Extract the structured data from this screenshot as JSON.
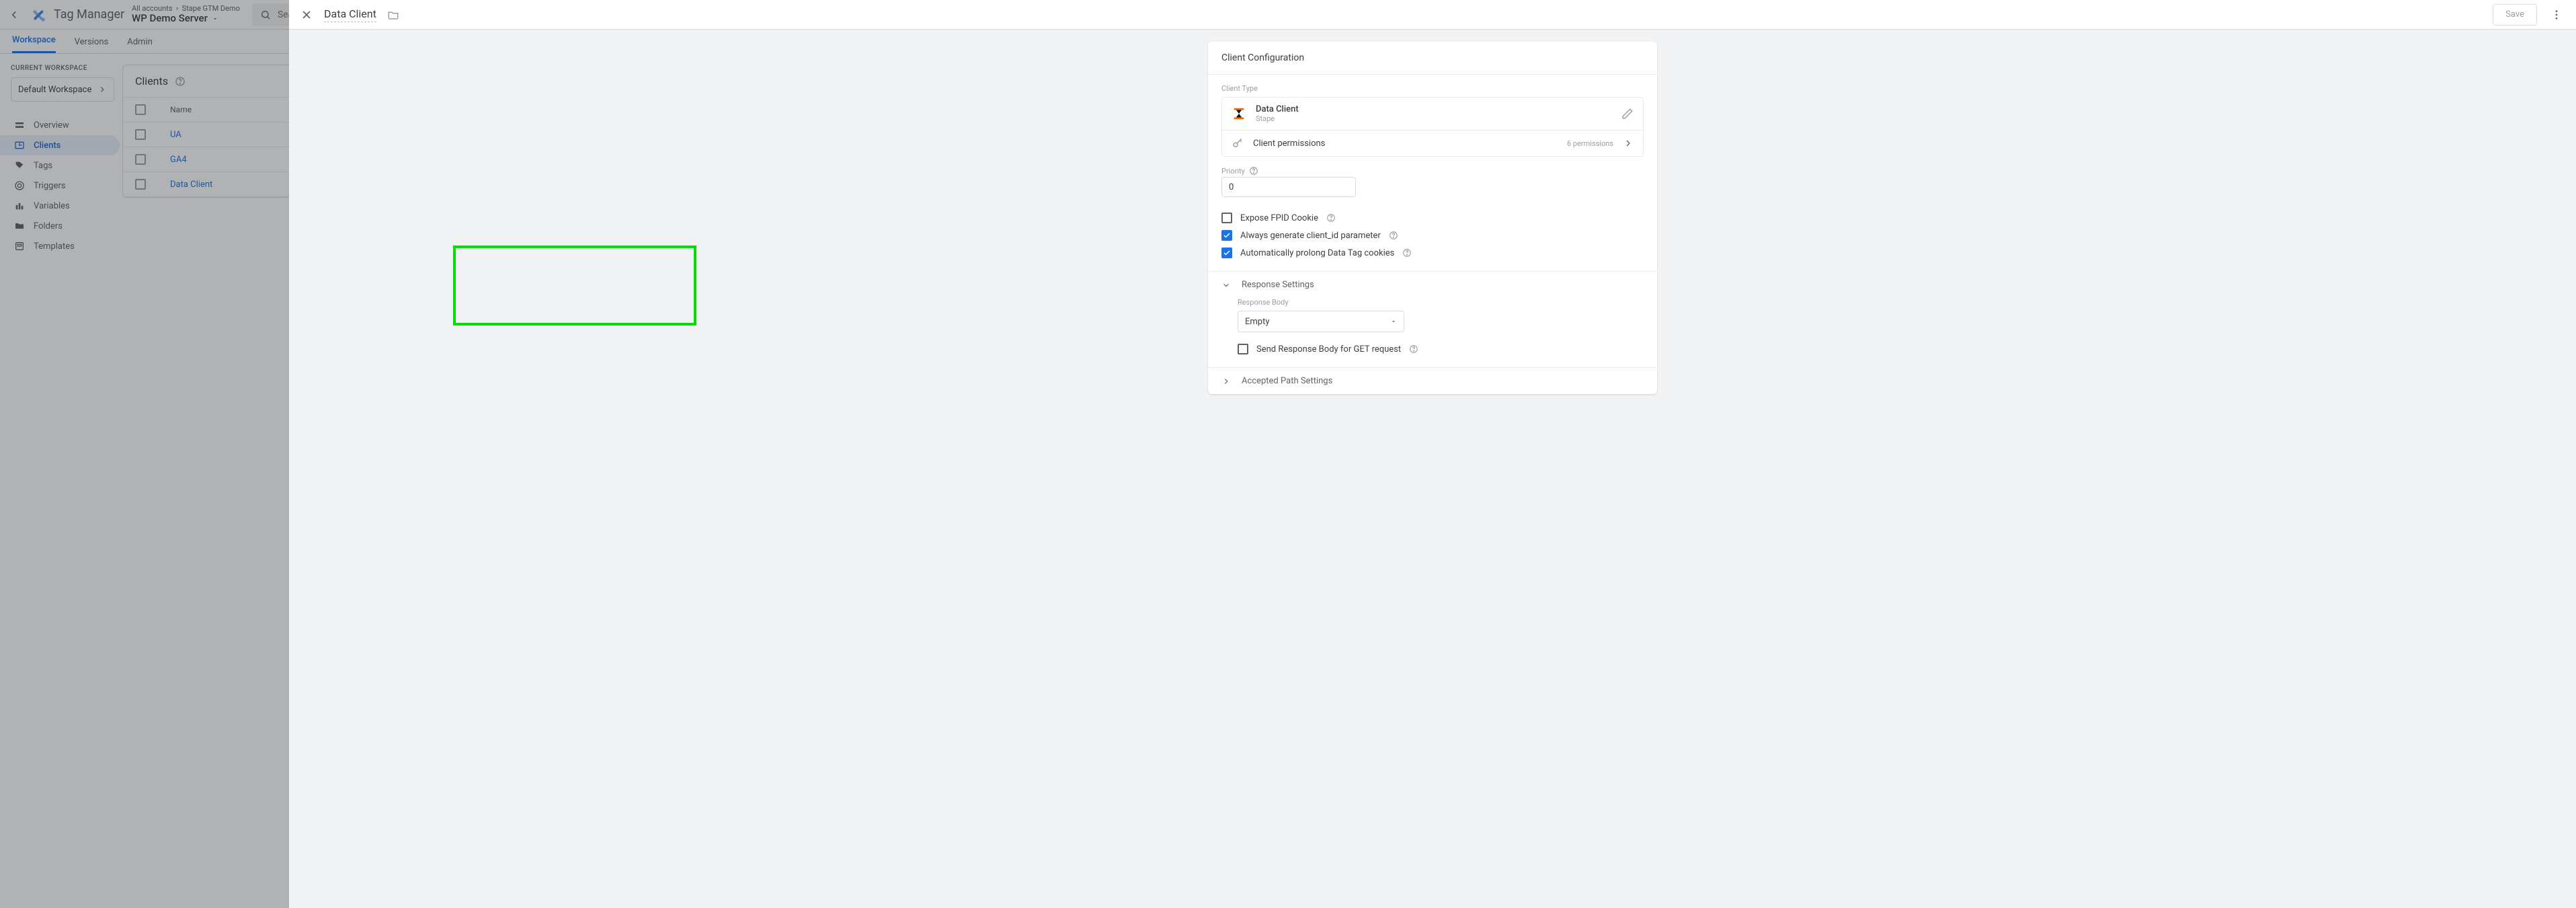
{
  "header": {
    "product": "Tag Manager",
    "breadcrumb_accounts": "All accounts",
    "breadcrumb_container": "Stape GTM Demo",
    "workspace_name": "WP Demo Server",
    "search_placeholder": "Search w"
  },
  "nav": {
    "tabs": [
      "Workspace",
      "Versions",
      "Admin"
    ],
    "active": 0
  },
  "sidebar": {
    "current_ws_label": "CURRENT WORKSPACE",
    "current_ws": "Default Workspace",
    "items": [
      {
        "label": "Overview"
      },
      {
        "label": "Clients"
      },
      {
        "label": "Tags"
      },
      {
        "label": "Triggers"
      },
      {
        "label": "Variables"
      },
      {
        "label": "Folders"
      },
      {
        "label": "Templates"
      }
    ],
    "active": 1
  },
  "clients_card": {
    "title": "Clients",
    "col_name": "Name",
    "rows": [
      "UA",
      "GA4",
      "Data Client"
    ]
  },
  "panel": {
    "title": "Data Client",
    "save": "Save"
  },
  "config": {
    "title": "Client Configuration",
    "client_type_label": "Client Type",
    "client_name": "Data Client",
    "client_vendor": "Stape",
    "permissions_label": "Client permissions",
    "permissions_count": "6 permissions",
    "priority_label": "Priority",
    "priority_value": "0",
    "ck_fpid": "Expose FPID Cookie",
    "ck_clientid": "Always generate client_id parameter",
    "ck_prolong": "Automatically prolong Data Tag cookies",
    "response_header": "Response Settings",
    "response_body_label": "Response Body",
    "response_body_value": "Empty",
    "ck_get": "Send Response Body for GET request",
    "paths_header": "Accepted Path Settings"
  }
}
